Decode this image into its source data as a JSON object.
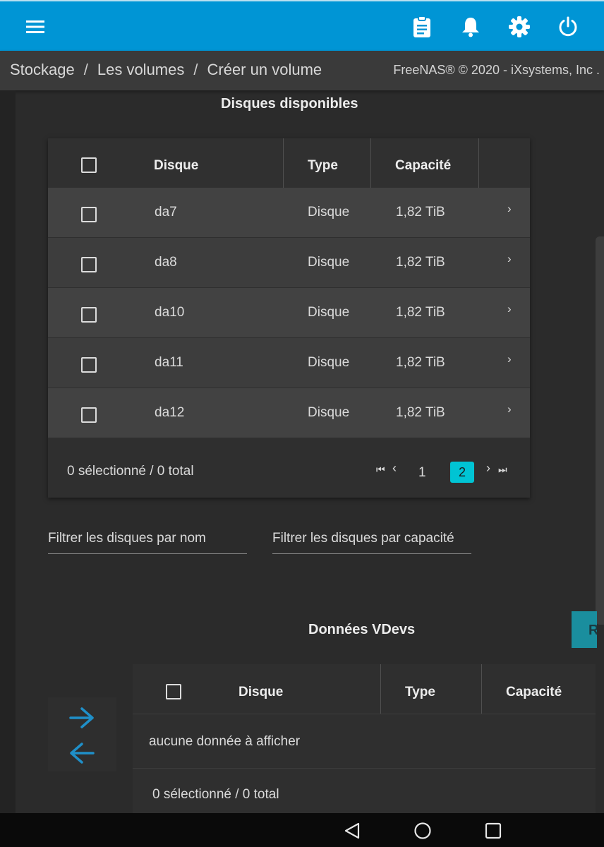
{
  "topbar": {
    "bg_color": "#0095d5",
    "icons": [
      "menu-icon",
      "clipboard-icon",
      "bell-icon",
      "gear-icon",
      "power-icon"
    ]
  },
  "breadcrumb": {
    "items": [
      "Stockage",
      "Les volumes",
      "Créer un volume"
    ],
    "separator": "/",
    "copyright": "FreeNAS® © 2020 - iXsystems, Inc ."
  },
  "available": {
    "title": "Disques disponibles",
    "columns": {
      "disk": "Disque",
      "type": "Type",
      "capacity": "Capacité"
    },
    "rows": [
      {
        "name": "da7",
        "type": "Disque",
        "capacity": "1,82 TiB"
      },
      {
        "name": "da8",
        "type": "Disque",
        "capacity": "1,82 TiB"
      },
      {
        "name": "da10",
        "type": "Disque",
        "capacity": "1,82 TiB"
      },
      {
        "name": "da11",
        "type": "Disque",
        "capacity": "1,82 TiB"
      },
      {
        "name": "da12",
        "type": "Disque",
        "capacity": "1,82 TiB"
      }
    ],
    "footer": "0 sélectionné / 0 total",
    "pager": {
      "first": "⏮",
      "prev": "‹",
      "page1": "1",
      "page2": "2",
      "next": "›",
      "last": "⏭"
    }
  },
  "filters": {
    "by_name": "Filtrer les disques par nom",
    "by_capacity": "Filtrer les disques par capacité"
  },
  "vdevs": {
    "title": "Données VDevs",
    "button_fragment": "R",
    "columns": {
      "disk": "Disque",
      "type": "Type",
      "capacity": "Capacité"
    },
    "empty": "aucune donnée à afficher",
    "footer": "0 sélectionné / 0 total"
  },
  "colors": {
    "accent": "#00c4d4",
    "arrow": "#1f8fc8"
  }
}
